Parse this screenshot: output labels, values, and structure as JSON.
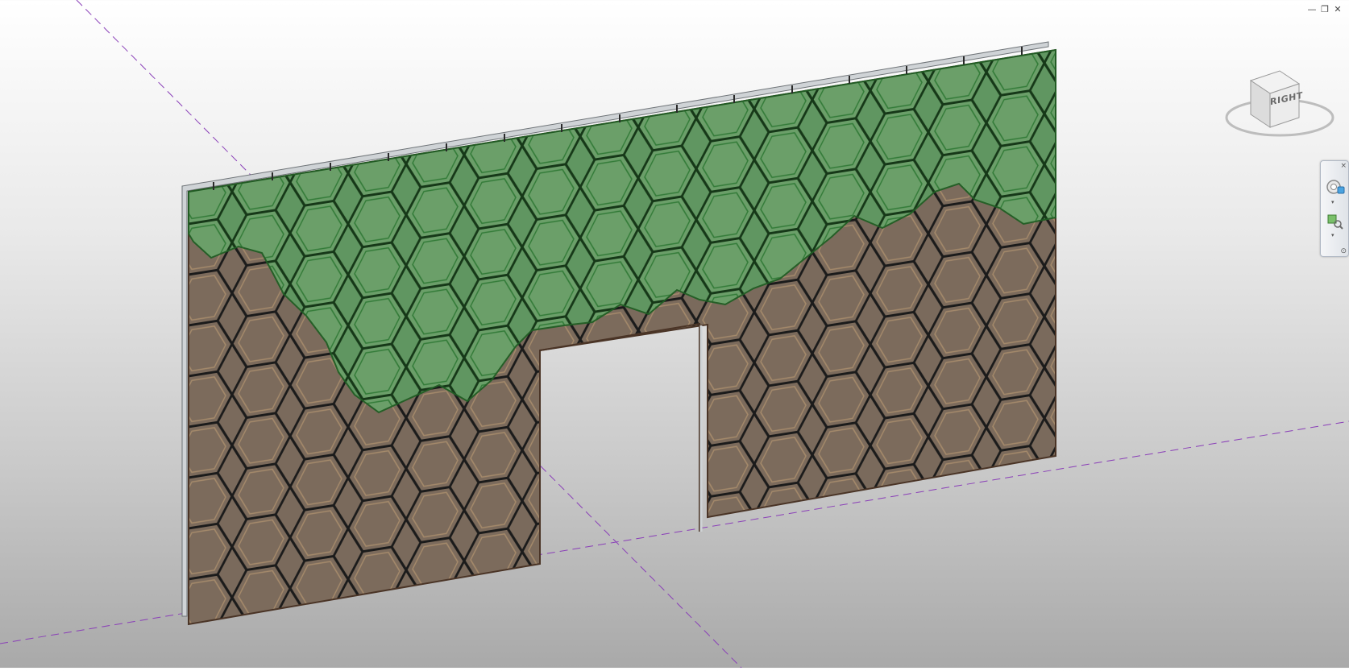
{
  "window_controls": {
    "minimize": "—",
    "restore": "❐",
    "close": "✕"
  },
  "viewcube": {
    "face_label": "RIGHT"
  },
  "navigation_bar": {
    "close": "×",
    "dropdown": "▾",
    "bottom_toggle": "⊙"
  },
  "colors": {
    "green_panel": "#2f8a3a",
    "brown_panel": "#6b4a30",
    "axis_line": "#8a3fb8",
    "hex_outline": "#1b1b1b"
  }
}
